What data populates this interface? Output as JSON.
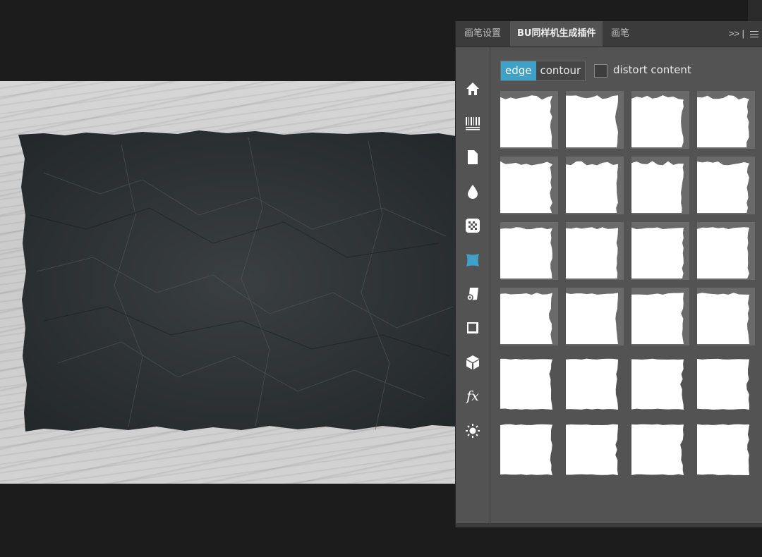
{
  "panel": {
    "tabs": [
      {
        "label": "画笔设置",
        "active": false
      },
      {
        "label": "BU同样机生成插件",
        "active": true
      },
      {
        "label": "画笔",
        "active": false
      }
    ],
    "more_label": ">>  |"
  },
  "sidebar": {
    "icons": [
      "home-icon",
      "barcode-icon",
      "document-icon",
      "drop-icon",
      "checker-icon",
      "frame-icon",
      "scroll-icon",
      "square-shadow-icon",
      "cube-icon",
      "fx-icon",
      "sun-icon"
    ],
    "fx_label": "fx",
    "active_icon": "frame-icon",
    "accent": "#3fa0c8"
  },
  "options": {
    "mode_edge": "edge",
    "mode_contour": "contour",
    "selected_mode": "edge",
    "distort_label": "distort content",
    "distort_checked": false
  },
  "presets": {
    "rows": 6,
    "cols": 4,
    "count": 24
  },
  "colors": {
    "panel_bg": "#535353",
    "tab_bg": "#3b3b3b",
    "accent": "#3fa0c8",
    "paper": "#2f3436"
  }
}
